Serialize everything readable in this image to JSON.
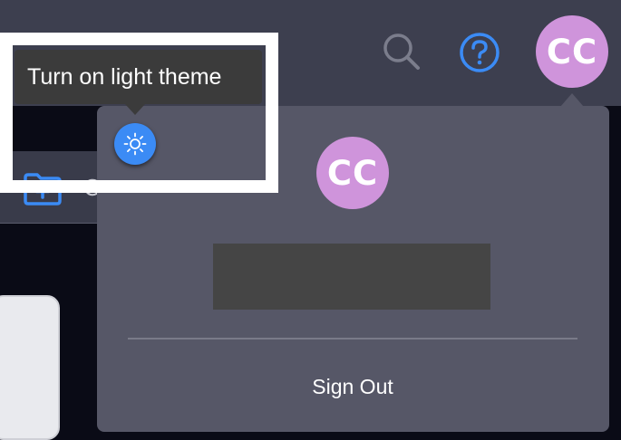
{
  "header": {
    "search_icon": "search-icon",
    "help_icon": "help-icon",
    "avatar_initials": "CC"
  },
  "content": {
    "folder_icon": "folder-add-icon",
    "folder_label_fragment": "C"
  },
  "account_menu": {
    "avatar_initials": "CC",
    "sign_out_label": "Sign Out"
  },
  "theme": {
    "tooltip": "Turn on light theme",
    "toggle_icon": "sun-icon"
  },
  "colors": {
    "accent": "#3b8bf5",
    "avatar": "#cf94db",
    "topbar": "#3d3f4f",
    "panel": "#565767",
    "highlight": "#ffffff"
  }
}
